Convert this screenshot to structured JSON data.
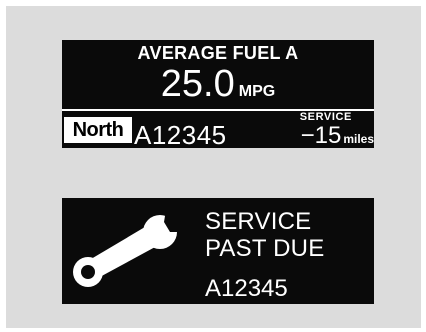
{
  "trip_display": {
    "title": "AVERAGE FUEL A",
    "fuel_value": "25.0",
    "fuel_unit": "MPG",
    "badge": "North",
    "plate": "A12345",
    "service_label": "SERVICE",
    "service_value": "−15",
    "service_unit": "miles"
  },
  "service_display": {
    "icon": "wrench-icon",
    "line1": "SERVICE",
    "line2": "PAST DUE",
    "plate": "A12345"
  },
  "colors": {
    "panel_bg": "#dcdcdc",
    "screen_bg": "#0a0a0a",
    "text": "#ffffff"
  }
}
